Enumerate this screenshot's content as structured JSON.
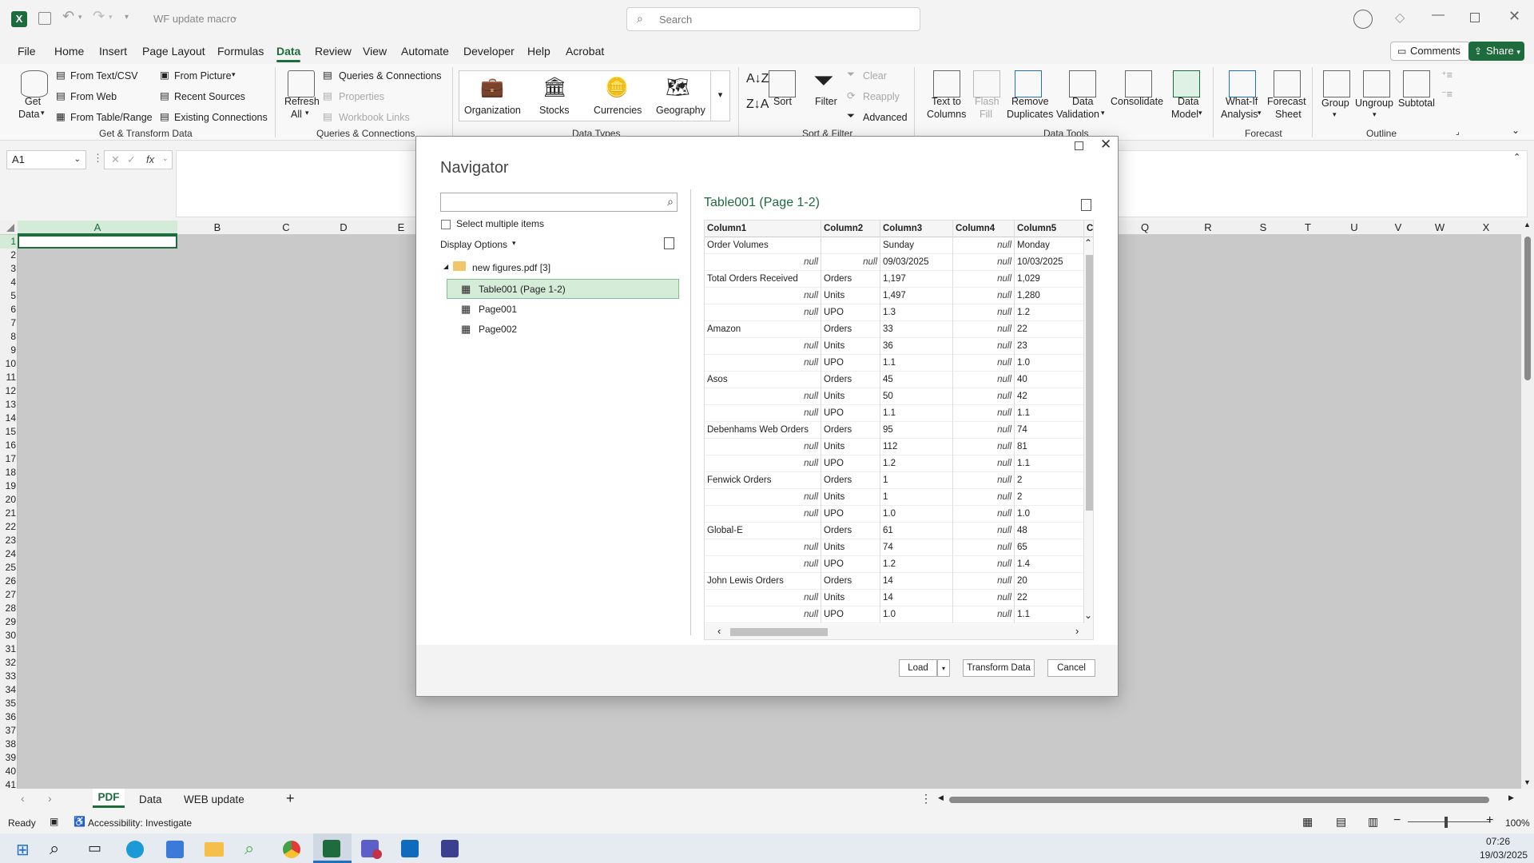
{
  "app": {
    "filename": "WF update macro",
    "search_placeholder": "Search",
    "accent": "#1e6b3e"
  },
  "menu": [
    "File",
    "Home",
    "Insert",
    "Page Layout",
    "Formulas",
    "Data",
    "Review",
    "View",
    "Automate",
    "Developer",
    "Help",
    "Acrobat"
  ],
  "comments_label": "Comments",
  "share_label": "Share",
  "ribbon": {
    "get_data": "Get\nData",
    "get_data_l1": "Get",
    "get_data_l2": "Data",
    "from_text_csv": "From Text/CSV",
    "from_web": "From Web",
    "from_table_range": "From Table/Range",
    "from_picture": "From Picture",
    "recent_sources": "Recent Sources",
    "existing_connections": "Existing Connections",
    "group_get_transform": "Get & Transform Data",
    "refresh_l1": "Refresh",
    "refresh_l2": "All",
    "queries_connections": "Queries & Connections",
    "properties": "Properties",
    "workbook_links": "Workbook Links",
    "group_queries": "Queries & Connections",
    "organization": "Organization",
    "stocks": "Stocks",
    "currencies": "Currencies",
    "geography": "Geography",
    "group_data_types": "Data Types",
    "sort": "Sort",
    "filter": "Filter",
    "clear": "Clear",
    "reapply": "Reapply",
    "advanced": "Advanced",
    "group_sort_filter": "Sort & Filter",
    "text_to_columns_l1": "Text to",
    "text_to_columns_l2": "Columns",
    "flash_fill_l1": "Flash",
    "flash_fill_l2": "Fill",
    "remove_dup_l1": "Remove",
    "remove_dup_l2": "Duplicates",
    "data_validation_l1": "Data",
    "data_validation_l2": "Validation",
    "consolidate": "Consolidate",
    "data_model_l1": "Data",
    "data_model_l2": "Model",
    "group_data_tools": "Data Tools",
    "what_if_l1": "What-If",
    "what_if_l2": "Analysis",
    "forecast_sheet_l1": "Forecast",
    "forecast_sheet_l2": "Sheet",
    "group_forecast": "Forecast",
    "group_btn": "Group",
    "ungroup_btn": "Ungroup",
    "subtotal": "Subtotal",
    "group_outline": "Outline"
  },
  "formula_bar": {
    "name_box": "A1",
    "fx": "fx"
  },
  "columns": [
    "A",
    "B",
    "C",
    "D",
    "E",
    "Q",
    "R",
    "S",
    "T",
    "U",
    "V",
    "W",
    "X"
  ],
  "rows": [
    "1",
    "2",
    "3",
    "4",
    "5",
    "6",
    "7",
    "8",
    "9",
    "10",
    "11",
    "12",
    "13",
    "14",
    "15",
    "16",
    "17",
    "18",
    "19",
    "20",
    "21",
    "22",
    "23",
    "24",
    "25",
    "26",
    "27",
    "28",
    "29",
    "30",
    "31",
    "32",
    "33",
    "34",
    "35",
    "36",
    "37",
    "38",
    "39",
    "40",
    "41"
  ],
  "sheets": [
    "PDF",
    "Data",
    "WEB update"
  ],
  "status": {
    "ready": "Ready",
    "accessibility": "Accessibility: Investigate",
    "zoom": "100%"
  },
  "clock": {
    "time": "07:26",
    "date": "19/03/2025"
  },
  "navigator": {
    "title": "Navigator",
    "select_multiple": "Select multiple items",
    "display_options": "Display Options",
    "tree": {
      "folder": "new figures.pdf [3]",
      "items": [
        "Table001 (Page 1-2)",
        "Page001",
        "Page002"
      ]
    },
    "preview_title": "Table001 (Page 1-2)",
    "headers": [
      "Column1",
      "Column2",
      "Column3",
      "Column4",
      "Column5",
      "Co"
    ],
    "rows": [
      [
        "Order Volumes",
        "",
        "Sunday",
        "null",
        "Monday"
      ],
      [
        "null",
        "null",
        "09/03/2025",
        "null",
        "10/03/2025"
      ],
      [
        "Total Orders Received",
        "Orders",
        "1,197",
        "null",
        "1,029"
      ],
      [
        "null",
        "Units",
        "1,497",
        "null",
        "1,280"
      ],
      [
        "null",
        "UPO",
        "1.3",
        "null",
        "1.2"
      ],
      [
        "Amazon",
        "Orders",
        "33",
        "null",
        "22"
      ],
      [
        "null",
        "Units",
        "36",
        "null",
        "23"
      ],
      [
        "null",
        "UPO",
        "1.1",
        "null",
        "1.0"
      ],
      [
        "Asos",
        "Orders",
        "45",
        "null",
        "40"
      ],
      [
        "null",
        "Units",
        "50",
        "null",
        "42"
      ],
      [
        "null",
        "UPO",
        "1.1",
        "null",
        "1.1"
      ],
      [
        "Debenhams Web Orders",
        "Orders",
        "95",
        "null",
        "74"
      ],
      [
        "null",
        "Units",
        "112",
        "null",
        "81"
      ],
      [
        "null",
        "UPO",
        "1.2",
        "null",
        "1.1"
      ],
      [
        "Fenwick Orders",
        "Orders",
        "1",
        "null",
        "2"
      ],
      [
        "null",
        "Units",
        "1",
        "null",
        "2"
      ],
      [
        "null",
        "UPO",
        "1.0",
        "null",
        "1.0"
      ],
      [
        "Global-E",
        "Orders",
        "61",
        "null",
        "48"
      ],
      [
        "null",
        "Units",
        "74",
        "null",
        "65"
      ],
      [
        "null",
        "UPO",
        "1.2",
        "null",
        "1.4"
      ],
      [
        "John Lewis Orders",
        "Orders",
        "14",
        "null",
        "20"
      ],
      [
        "null",
        "Units",
        "14",
        "null",
        "22"
      ],
      [
        "null",
        "UPO",
        "1.0",
        "null",
        "1.1"
      ]
    ],
    "load": "Load",
    "transform": "Transform Data",
    "cancel": "Cancel"
  }
}
